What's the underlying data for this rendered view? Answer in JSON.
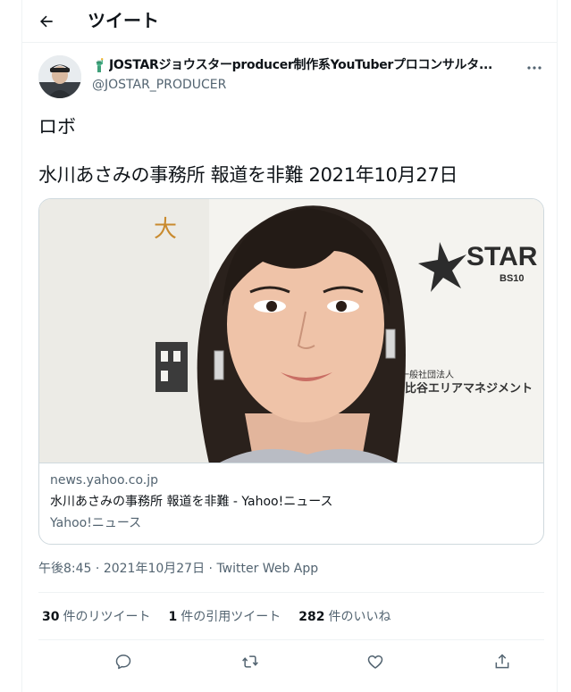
{
  "header": {
    "back_icon": "arrow-left-icon",
    "title": "ツイート"
  },
  "author": {
    "name": "JOSTARジョウスターproducer制作系YouTuberプロコンサルタ...",
    "handle": "@JOSTAR_PRODUCER",
    "name_emoji": "statue-of-liberty-icon"
  },
  "tweet": {
    "line1": "ロボ",
    "line2": "水川あさみの事務所 報道を非難 2021年10月27日"
  },
  "card": {
    "domain": "news.yahoo.co.jp",
    "title": "水川あさみの事務所 報道を非難 - Yahoo!ニュース",
    "source": "Yahoo!ニュース",
    "image_texts": {
      "star_logo": "STAR",
      "star_sub": "BS10",
      "org_small": "一般社団法人",
      "org_name": "日比谷エリアマネジメント"
    }
  },
  "meta": {
    "time": "午後8:45",
    "sep1": " · ",
    "date": "2021年10月27日",
    "sep2": " · ",
    "client": "Twitter Web App"
  },
  "stats": {
    "retweets_count": "30",
    "retweets_label": "件のリツイート",
    "quotes_count": "1",
    "quotes_label": "件の引用ツイート",
    "likes_count": "282",
    "likes_label": "件のいいね"
  },
  "actions": {
    "reply_icon": "reply-icon",
    "retweet_icon": "retweet-icon",
    "like_icon": "heart-icon",
    "share_icon": "share-icon"
  },
  "colors": {
    "text_primary": "#0f1419",
    "text_secondary": "#536471",
    "border": "#cfd9de",
    "divider": "#eff3f4",
    "background": "#ffffff"
  }
}
